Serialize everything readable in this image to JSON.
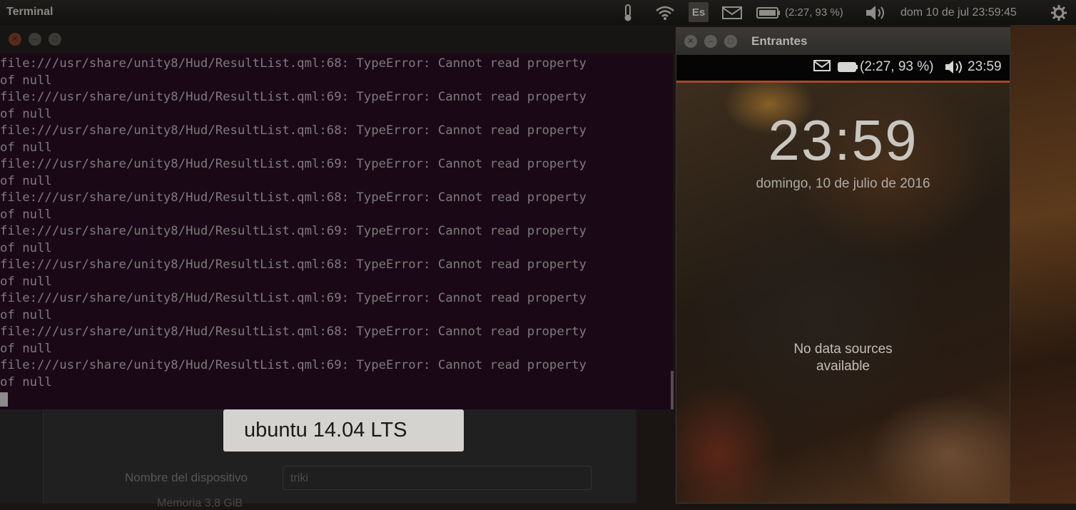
{
  "top_panel": {
    "app_title": "Terminal",
    "keyboard_layout": "Es",
    "battery_text": "(2:27, 93 %)",
    "clock": "dom 10 de jul 23:59:45",
    "icons": [
      "thermometer-icon",
      "wifi-icon",
      "keyboard-icon",
      "mail-icon",
      "battery-icon",
      "sound-icon",
      "gear-icon"
    ]
  },
  "terminal": {
    "lines": [
      "file:///usr/share/unity8/Hud/ResultList.qml:68: TypeError: Cannot read property",
      "of null",
      "file:///usr/share/unity8/Hud/ResultList.qml:69: TypeError: Cannot read property",
      "of null",
      "file:///usr/share/unity8/Hud/ResultList.qml:68: TypeError: Cannot read property",
      "of null",
      "file:///usr/share/unity8/Hud/ResultList.qml:69: TypeError: Cannot read property",
      "of null",
      "file:///usr/share/unity8/Hud/ResultList.qml:68: TypeError: Cannot read property",
      "of null",
      "file:///usr/share/unity8/Hud/ResultList.qml:69: TypeError: Cannot read property",
      "of null",
      "file:///usr/share/unity8/Hud/ResultList.qml:68: TypeError: Cannot read property",
      "of null",
      "file:///usr/share/unity8/Hud/ResultList.qml:69: TypeError: Cannot read property",
      "of null",
      "file:///usr/share/unity8/Hud/ResultList.qml:68: TypeError: Cannot read property",
      "of null",
      "file:///usr/share/unity8/Hud/ResultList.qml:69: TypeError: Cannot read property",
      "of null"
    ]
  },
  "settings": {
    "os_badge": "ubuntu 14.04 LTS",
    "device_name_label": "Nombre del dispositivo",
    "device_name_value": "triki",
    "memory_label": "Memoria    3,8 GiB"
  },
  "phone": {
    "window_title": "Entrantes",
    "status_battery": "(2:27, 93 %)",
    "status_time": "23:59",
    "lock_time": "23:59",
    "lock_date": "domingo, 10 de julio de 2016",
    "no_data_line1": "No data sources",
    "no_data_line2": "available"
  },
  "colors": {
    "terminal_bg": "#1b0817",
    "terminal_text": "#7e7a7b",
    "accent": "#a44a2a"
  }
}
